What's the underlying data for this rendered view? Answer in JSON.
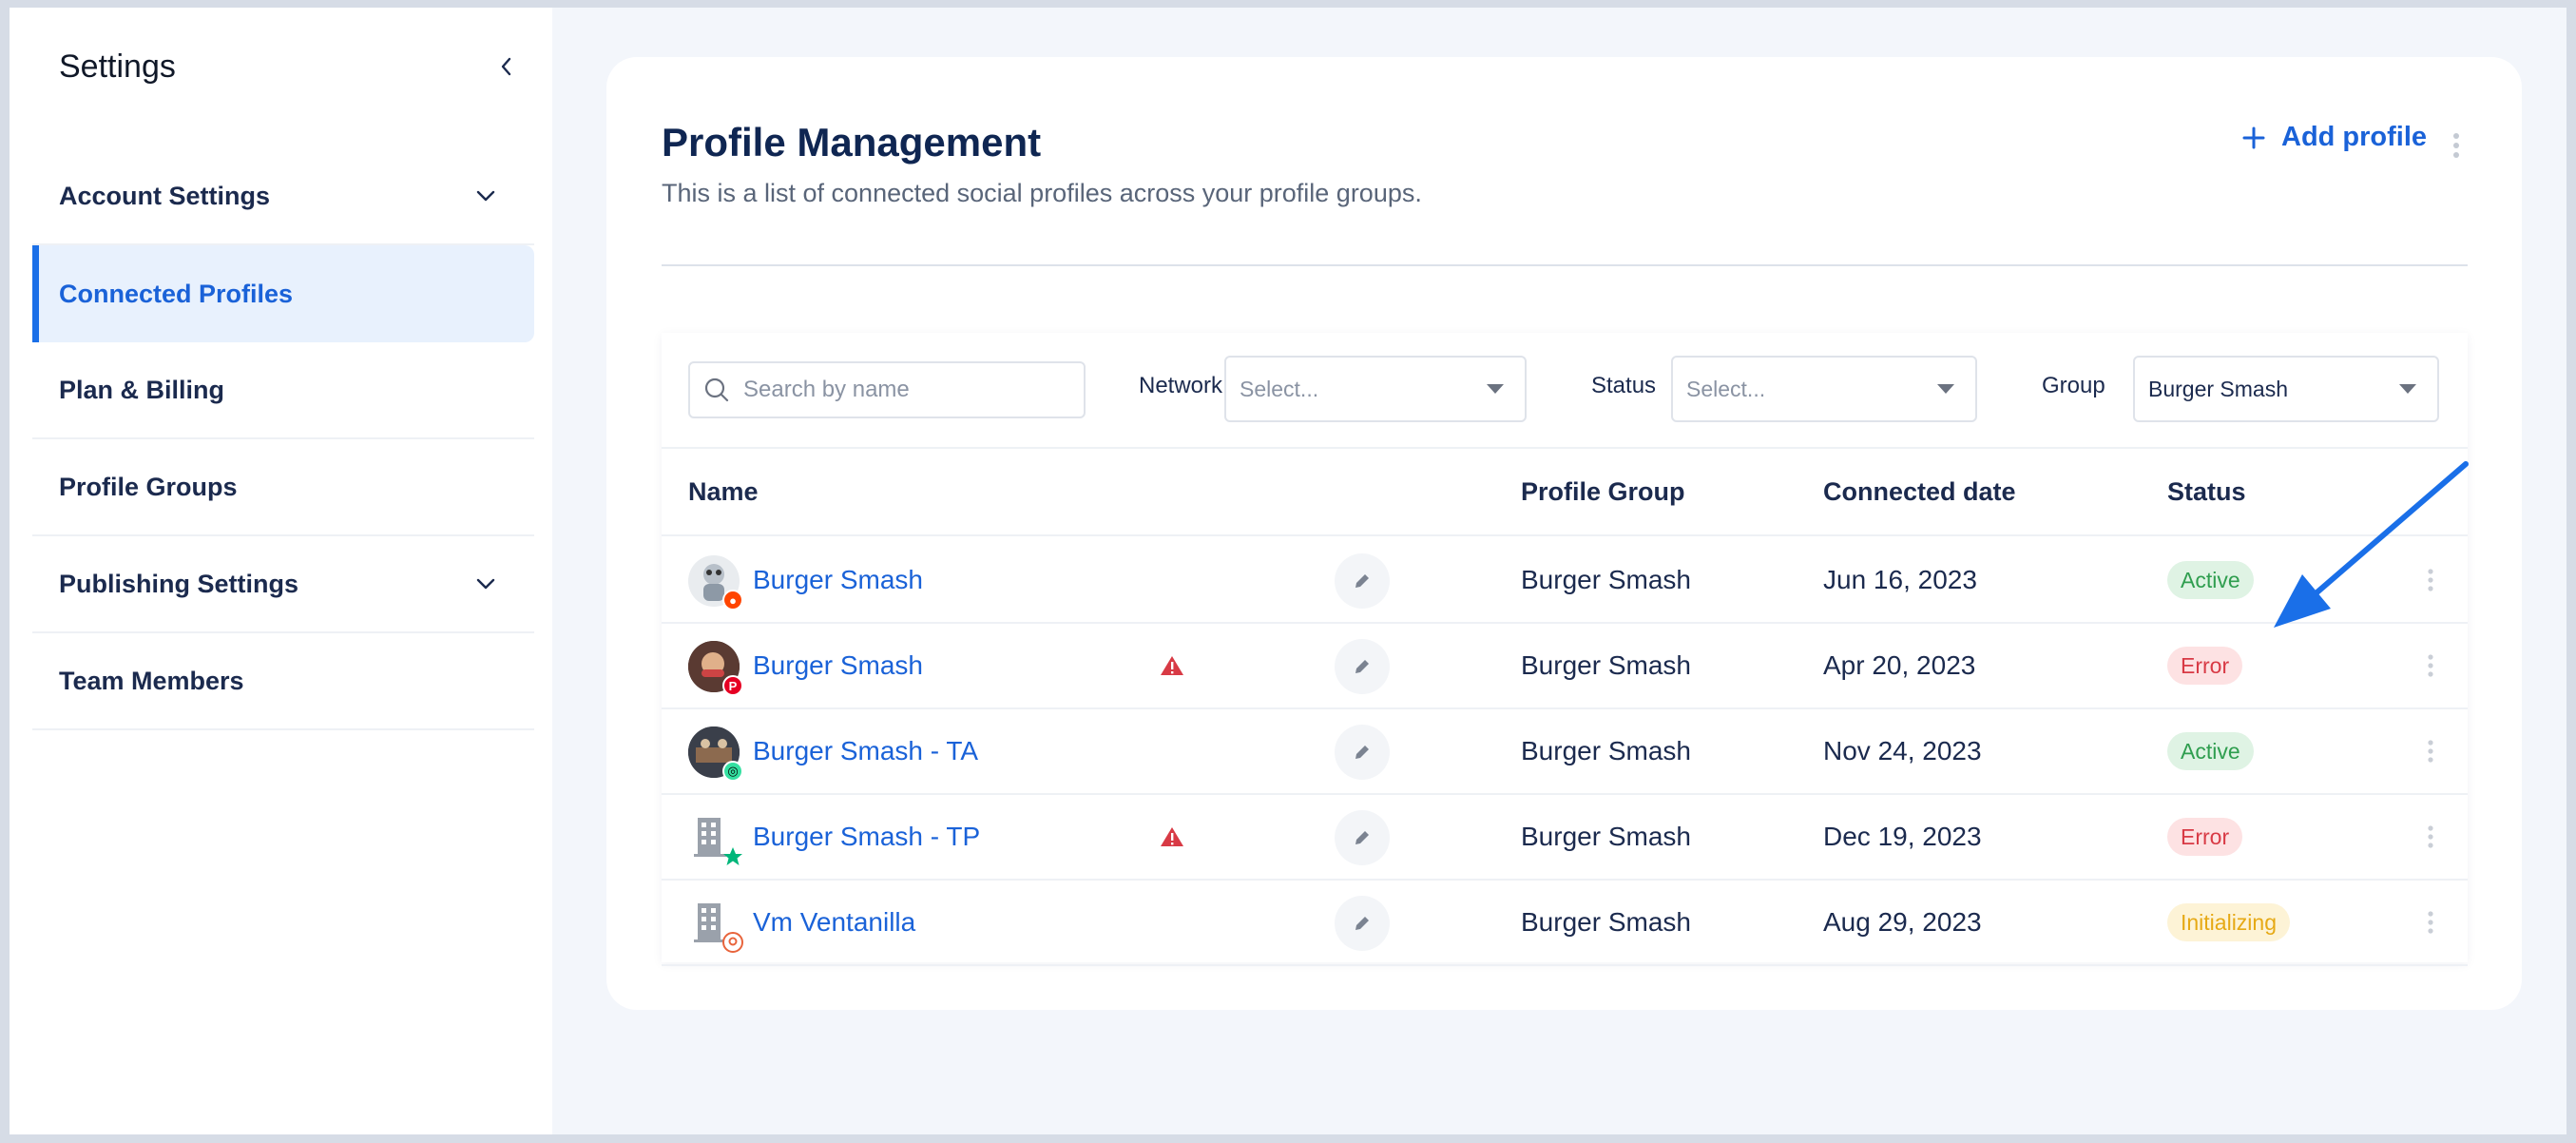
{
  "sidebar": {
    "title": "Settings",
    "items": [
      {
        "label": "Account Settings",
        "expandable": true,
        "active": false
      },
      {
        "label": "Connected Profiles",
        "expandable": false,
        "active": true
      },
      {
        "label": "Plan & Billing",
        "expandable": false,
        "active": false
      },
      {
        "label": "Profile Groups",
        "expandable": false,
        "active": false
      },
      {
        "label": "Publishing Settings",
        "expandable": true,
        "active": false
      },
      {
        "label": "Team Members",
        "expandable": false,
        "active": false
      }
    ]
  },
  "header": {
    "title": "Profile Management",
    "subtitle": "This is a list of connected social profiles across your profile groups.",
    "add_button_label": "Add profile"
  },
  "filters": {
    "search_placeholder": "Search by name",
    "network_label": "Network",
    "network_value": "Select...",
    "status_label": "Status",
    "status_value": "Select...",
    "group_label": "Group",
    "group_value": "Burger Smash"
  },
  "table": {
    "columns": {
      "name": "Name",
      "group": "Profile Group",
      "date": "Connected date",
      "status": "Status"
    },
    "rows": [
      {
        "name": "Burger Smash",
        "group": "Burger Smash",
        "date": "Jun 16, 2023",
        "status": "Active",
        "warning": false,
        "avatar": "reddit-avatar"
      },
      {
        "name": "Burger Smash",
        "group": "Burger Smash",
        "date": "Apr 20, 2023",
        "status": "Error",
        "warning": true,
        "avatar": "pinterest-avatar"
      },
      {
        "name": "Burger Smash - TA",
        "group": "Burger Smash",
        "date": "Nov 24, 2023",
        "status": "Active",
        "warning": false,
        "avatar": "tripadvisor-avatar"
      },
      {
        "name": "Burger Smash - TP",
        "group": "Burger Smash",
        "date": "Dec 19, 2023",
        "status": "Error",
        "warning": true,
        "avatar": "trustpilot-building-avatar"
      },
      {
        "name": "Vm Ventanilla",
        "group": "Burger Smash",
        "date": "Aug 29, 2023",
        "status": "Initializing",
        "warning": false,
        "avatar": "google-business-building-avatar"
      }
    ]
  },
  "colors": {
    "accent": "#1a62d8",
    "active_bg": "#dff3e4",
    "error_bg": "#fde2e3",
    "initializing_bg": "#fdf3d6",
    "annotation_arrow": "#1a6fe8"
  }
}
